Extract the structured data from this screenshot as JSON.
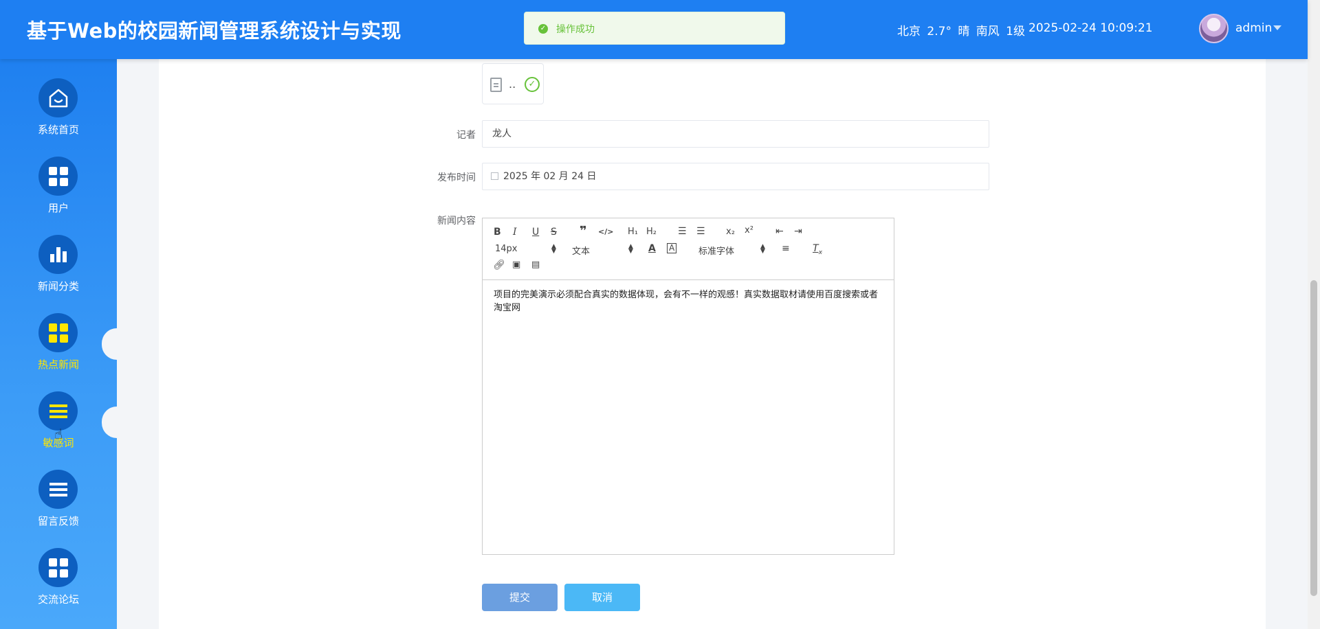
{
  "header": {
    "app_title": "基于Web的校园新闻管理系统设计与实现",
    "toast_text": "操作成功",
    "weather": "北京 2.7° 晴 南风 1级",
    "datetime": "2025-02-24 10:09:21",
    "username": "admin"
  },
  "sidebar": {
    "items": [
      {
        "label": "系统首页",
        "icon": "home-icon"
      },
      {
        "label": "用户",
        "icon": "grid-icon"
      },
      {
        "label": "新闻分类",
        "icon": "bar-chart-icon"
      },
      {
        "label": "热点新闻",
        "icon": "grid-icon",
        "active": true
      },
      {
        "label": "敏感词",
        "icon": "list-icon",
        "active": true
      },
      {
        "label": "留言反馈",
        "icon": "list-icon"
      },
      {
        "label": "交流论坛",
        "icon": "grid-icon"
      }
    ]
  },
  "form": {
    "file_name": "..",
    "reporter_label": "记者",
    "reporter_value": "龙人",
    "publish_time_label": "发布时间",
    "publish_time_value": "2025 年 02 月 24 日",
    "content_label": "新闻内容",
    "content_text": "项目的完美演示必须配合真实的数据体现，会有不一样的观感！真实数据取材请使用百度搜索或者淘宝网"
  },
  "editor_toolbar": {
    "font_size": "14px",
    "header_select": "文本",
    "font_family": "标准字体"
  },
  "buttons": {
    "submit": "提交",
    "cancel": "取消"
  },
  "colors": {
    "header_bg": "#1e7ff2",
    "active_nav": "#ffe600",
    "success": "#67c23a"
  }
}
